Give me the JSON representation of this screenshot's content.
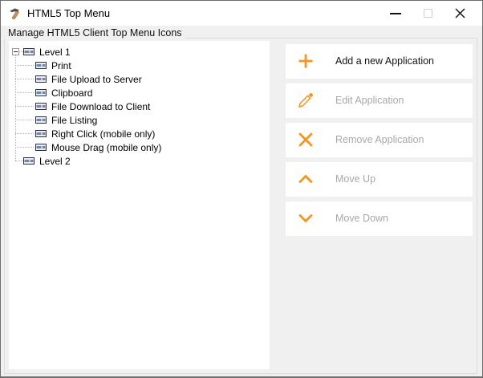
{
  "window": {
    "title": "HTML5 Top Menu"
  },
  "groupbox": {
    "label": "Manage HTML5 Client Top Menu Icons"
  },
  "tree": {
    "roots": [
      "Level 1",
      "Level 2"
    ],
    "children": [
      "Print",
      "File Upload to Server",
      "Clipboard",
      "File Download to Client",
      "File Listing",
      "Right Click (mobile only)",
      "Mouse Drag (mobile only)"
    ]
  },
  "buttons": [
    {
      "label": "Add a new Application",
      "icon": "plus-icon",
      "enabled": true
    },
    {
      "label": "Edit Application",
      "icon": "pencil-icon",
      "enabled": false
    },
    {
      "label": "Remove Application",
      "icon": "x-icon",
      "enabled": false
    },
    {
      "label": "Move Up",
      "icon": "chevron-up-icon",
      "enabled": false
    },
    {
      "label": "Move Down",
      "icon": "chevron-down-icon",
      "enabled": false
    }
  ],
  "colors": {
    "accent": "#f7941e",
    "disabled_text": "#a8a8a8",
    "client_bg": "#f0f0f0",
    "titlebar_bg": "#ffffff"
  }
}
